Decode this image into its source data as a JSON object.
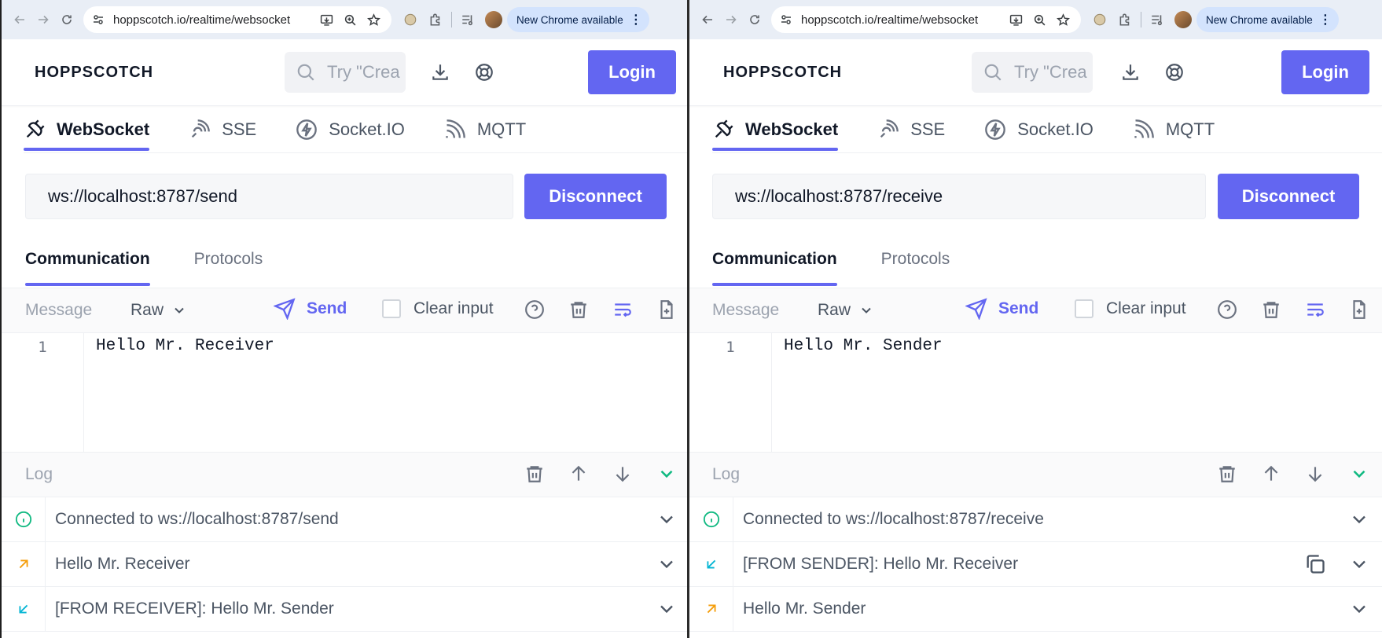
{
  "colors": {
    "accent": "#6366f1",
    "info": "#10b981",
    "outgoing": "#f59e0b",
    "incoming": "#06b6d4"
  },
  "browser": {
    "url": "hoppscotch.io/realtime/websocket",
    "update_label": "New Chrome available"
  },
  "app": {
    "logo": "HOPPSCOTCH",
    "search_placeholder": "Try \"Crea",
    "search_placeholder_right": "Try \"Crea",
    "login_label": "Login",
    "protocol_tabs": [
      "WebSocket",
      "SSE",
      "Socket.IO",
      "MQTT"
    ],
    "disconnect_label": "Disconnect",
    "sub_tabs": [
      "Communication",
      "Protocols"
    ],
    "message_label": "Message",
    "format_label": "Raw",
    "send_label": "Send",
    "clear_input_label": "Clear input",
    "log_label": "Log",
    "line_number": "1"
  },
  "left": {
    "ws_url": "ws://localhost:8787/send",
    "editor_text": "Hello Mr. Receiver",
    "log": [
      {
        "type": "info",
        "text": "Connected to ws://localhost:8787/send"
      },
      {
        "type": "outgoing",
        "text": "Hello Mr. Receiver"
      },
      {
        "type": "incoming",
        "text": "[FROM RECEIVER]: Hello Mr. Sender"
      }
    ]
  },
  "right": {
    "ws_url": "ws://localhost:8787/receive",
    "editor_text": "Hello Mr. Sender",
    "log": [
      {
        "type": "info",
        "text": "Connected to ws://localhost:8787/receive"
      },
      {
        "type": "incoming",
        "text": "[FROM SENDER]: Hello Mr. Receiver"
      },
      {
        "type": "outgoing",
        "text": "Hello Mr. Sender"
      }
    ]
  }
}
